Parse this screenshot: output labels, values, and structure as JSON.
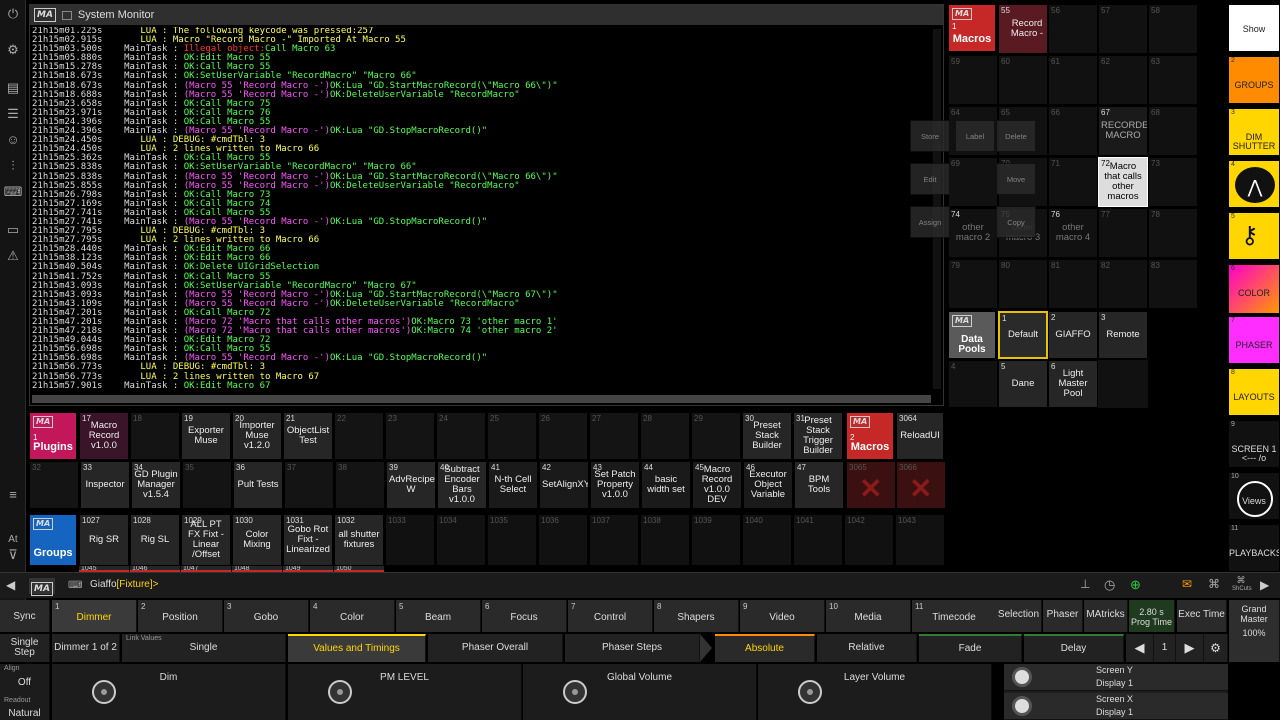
{
  "app": {
    "window_title": "System Monitor",
    "logo": "MA"
  },
  "leftbar": {
    "buttons": [
      "power-icon",
      "gear-icon",
      "clipboard-icon",
      "sliders-icon",
      "user-icon",
      "faders-icon",
      "keyboard-icon",
      "display-icon",
      "warning-icon",
      "list-icon",
      "filter-icon"
    ],
    "at_label": "At"
  },
  "log_lines": [
    [
      [
        "21h15m01.225s       ",
        "ts"
      ],
      [
        "LUA : ",
        "y"
      ],
      [
        "The following keycode was pressed:257",
        "y"
      ]
    ],
    [
      [
        "21h15m02.915s       ",
        "ts"
      ],
      [
        "LUA : ",
        "y"
      ],
      [
        "Macro \"Record Macro -\" Imported At Macro 55",
        "y"
      ]
    ],
    [
      [
        "21h15m03.500s    MainTask : ",
        "ts"
      ],
      [
        "Illegal object:",
        "r"
      ],
      [
        "Call Macro 63",
        "g"
      ]
    ],
    [
      [
        "21h15m05.880s    MainTask : ",
        "ts"
      ],
      [
        "OK:Edit Macro 55",
        "g"
      ]
    ],
    [
      [
        "21h15m15.278s    MainTask : ",
        "ts"
      ],
      [
        "OK:Call Macro 55",
        "g"
      ]
    ],
    [
      [
        "21h15m18.673s    MainTask : ",
        "ts"
      ],
      [
        "OK:SetUserVariable \"RecordMacro\" \"Macro 66\"",
        "g"
      ]
    ],
    [
      [
        "21h15m18.673s    MainTask : ",
        "ts"
      ],
      [
        "(Macro 55 'Record Macro -')",
        "m"
      ],
      [
        "OK:Lua \"GD.StartMacroRecord(\\\"Macro 66\\\")\"",
        "g"
      ]
    ],
    [
      [
        "21h15m18.688s    MainTask : ",
        "ts"
      ],
      [
        "(Macro 55 'Record Macro -')",
        "m"
      ],
      [
        "OK:DeleteUserVariable \"RecordMacro\"",
        "g"
      ]
    ],
    [
      [
        "21h15m23.658s    MainTask : ",
        "ts"
      ],
      [
        "OK:Call Macro 75",
        "g"
      ]
    ],
    [
      [
        "21h15m23.971s    MainTask : ",
        "ts"
      ],
      [
        "OK:Call Macro 76",
        "g"
      ]
    ],
    [
      [
        "21h15m24.396s    MainTask : ",
        "ts"
      ],
      [
        "OK:Call Macro 55",
        "g"
      ]
    ],
    [
      [
        "21h15m24.396s    MainTask : ",
        "ts"
      ],
      [
        "(Macro 55 'Record Macro -')",
        "m"
      ],
      [
        "OK:Lua \"GD.StopMacroRecord()\"",
        "g"
      ]
    ],
    [
      [
        "21h15m24.450s       ",
        "ts"
      ],
      [
        "LUA : ",
        "y"
      ],
      [
        "DEBUG: #cmdTbl: 3",
        "y"
      ]
    ],
    [
      [
        "21h15m24.450s       ",
        "ts"
      ],
      [
        "LUA : ",
        "y"
      ],
      [
        "2 lines written to Macro 66",
        "y"
      ]
    ],
    [
      [
        "21h15m25.362s    MainTask : ",
        "ts"
      ],
      [
        "OK:Call Macro 55",
        "g"
      ]
    ],
    [
      [
        "21h15m25.838s    MainTask : ",
        "ts"
      ],
      [
        "OK:SetUserVariable \"RecordMacro\" \"Macro 66\"",
        "g"
      ]
    ],
    [
      [
        "21h15m25.838s    MainTask : ",
        "ts"
      ],
      [
        "(Macro 55 'Record Macro -')",
        "m"
      ],
      [
        "OK:Lua \"GD.StartMacroRecord(\\\"Macro 66\\\")\"",
        "g"
      ]
    ],
    [
      [
        "21h15m25.855s    MainTask : ",
        "ts"
      ],
      [
        "(Macro 55 'Record Macro -')",
        "m"
      ],
      [
        "OK:DeleteUserVariable \"RecordMacro\"",
        "g"
      ]
    ],
    [
      [
        "21h15m26.798s    MainTask : ",
        "ts"
      ],
      [
        "OK:Call Macro 73",
        "g"
      ]
    ],
    [
      [
        "21h15m27.169s    MainTask : ",
        "ts"
      ],
      [
        "OK:Call Macro 74",
        "g"
      ]
    ],
    [
      [
        "21h15m27.741s    MainTask : ",
        "ts"
      ],
      [
        "OK:Call Macro 55",
        "g"
      ]
    ],
    [
      [
        "21h15m27.741s    MainTask : ",
        "ts"
      ],
      [
        "(Macro 55 'Record Macro -')",
        "m"
      ],
      [
        "OK:Lua \"GD.StopMacroRecord()\"",
        "g"
      ]
    ],
    [
      [
        "21h15m27.795s       ",
        "ts"
      ],
      [
        "LUA : ",
        "y"
      ],
      [
        "DEBUG: #cmdTbl: 3",
        "y"
      ]
    ],
    [
      [
        "21h15m27.795s       ",
        "ts"
      ],
      [
        "LUA : ",
        "y"
      ],
      [
        "2 lines written to Macro 66",
        "y"
      ]
    ],
    [
      [
        "21h15m28.440s    MainTask : ",
        "ts"
      ],
      [
        "OK:Edit Macro 66",
        "g"
      ]
    ],
    [
      [
        "21h15m38.123s    MainTask : ",
        "ts"
      ],
      [
        "OK:Edit Macro 66",
        "g"
      ]
    ],
    [
      [
        "21h15m40.504s    MainTask : ",
        "ts"
      ],
      [
        "OK:Delete UIGridSelection",
        "g"
      ]
    ],
    [
      [
        "21h15m41.752s    MainTask : ",
        "ts"
      ],
      [
        "OK:Call Macro 55",
        "g"
      ]
    ],
    [
      [
        "21h15m43.093s    MainTask : ",
        "ts"
      ],
      [
        "OK:SetUserVariable \"RecordMacro\" \"Macro 67\"",
        "g"
      ]
    ],
    [
      [
        "21h15m43.093s    MainTask : ",
        "ts"
      ],
      [
        "(Macro 55 'Record Macro -')",
        "m"
      ],
      [
        "OK:Lua \"GD.StartMacroRecord(\\\"Macro 67\\\")\"",
        "g"
      ]
    ],
    [
      [
        "21h15m43.109s    MainTask : ",
        "ts"
      ],
      [
        "(Macro 55 'Record Macro -')",
        "m"
      ],
      [
        "OK:DeleteUserVariable \"RecordMacro\"",
        "g"
      ]
    ],
    [
      [
        "21h15m47.201s    MainTask : ",
        "ts"
      ],
      [
        "OK:Call Macro 72",
        "g"
      ]
    ],
    [
      [
        "21h15m47.201s    MainTask : ",
        "ts"
      ],
      [
        "(Macro 72 'Macro that calls other macros')",
        "m"
      ],
      [
        "OK:Macro 73 'other macro 1'",
        "g"
      ]
    ],
    [
      [
        "21h15m47.218s    MainTask : ",
        "ts"
      ],
      [
        "(Macro 72 'Macro that calls other macros')",
        "m"
      ],
      [
        "OK:Macro 74 'other macro 2'",
        "g"
      ]
    ],
    [
      [
        "21h15m49.044s    MainTask : ",
        "ts"
      ],
      [
        "OK:Edit Macro 72",
        "g"
      ]
    ],
    [
      [
        "21h15m56.698s    MainTask : ",
        "ts"
      ],
      [
        "OK:Call Macro 55",
        "g"
      ]
    ],
    [
      [
        "21h15m56.698s    MainTask : ",
        "ts"
      ],
      [
        "(Macro 55 'Record Macro -')",
        "m"
      ],
      [
        "OK:Lua \"GD.StopMacroRecord()\"",
        "g"
      ]
    ],
    [
      [
        "21h15m56.773s       ",
        "ts"
      ],
      [
        "LUA : ",
        "y"
      ],
      [
        "DEBUG: #cmdTbl: 3",
        "y"
      ]
    ],
    [
      [
        "21h15m56.773s       ",
        "ts"
      ],
      [
        "LUA : ",
        "y"
      ],
      [
        "2 lines written to Macro 67",
        "y"
      ]
    ],
    [
      [
        "21h15m57.901s    MainTask : ",
        "ts"
      ],
      [
        "OK:Edit Macro 67",
        "g"
      ]
    ]
  ],
  "macros_pool": {
    "header_number": "1",
    "header_label": "Macros",
    "tiles": [
      {
        "n": "55",
        "label": "Record Macro -"
      },
      {
        "n": "56",
        "label": ""
      },
      {
        "n": "57",
        "label": ""
      },
      {
        "n": "58",
        "label": ""
      },
      {
        "n": "59",
        "label": ""
      },
      {
        "n": "60",
        "label": ""
      },
      {
        "n": "61",
        "label": ""
      },
      {
        "n": "62",
        "label": ""
      },
      {
        "n": "63",
        "label": ""
      },
      {
        "n": "64",
        "label": ""
      },
      {
        "n": "65",
        "label": ""
      },
      {
        "n": "66",
        "label": ""
      },
      {
        "n": "67",
        "label": "RECORDED MACRO"
      },
      {
        "n": "68",
        "label": ""
      },
      {
        "n": "69",
        "label": ""
      },
      {
        "n": "70",
        "label": ""
      },
      {
        "n": "71",
        "label": ""
      },
      {
        "n": "72",
        "label": "Macro that calls other macros"
      },
      {
        "n": "73",
        "label": ""
      },
      {
        "n": "74",
        "label": "other macro 2"
      },
      {
        "n": "75",
        "label": "other macro 3"
      },
      {
        "n": "76",
        "label": "other macro 4"
      },
      {
        "n": "77",
        "label": ""
      },
      {
        "n": "78",
        "label": ""
      },
      {
        "n": "79",
        "label": ""
      },
      {
        "n": "80",
        "label": ""
      },
      {
        "n": "81",
        "label": ""
      },
      {
        "n": "82",
        "label": ""
      },
      {
        "n": "83",
        "label": ""
      },
      {
        "n": "84",
        "label": ""
      },
      {
        "n": "85",
        "label": ""
      },
      {
        "n": "86",
        "label": ""
      },
      {
        "n": "87",
        "label": ""
      },
      {
        "n": "88",
        "label": ""
      },
      {
        "n": "89",
        "label": ""
      }
    ]
  },
  "context_menu": {
    "store": "Store",
    "label": "Label",
    "delete": "Delete",
    "edit": "Edit",
    "move": "Move",
    "assign": "Assign",
    "copy": "Copy"
  },
  "data_pools": {
    "header": "Data Pools",
    "tiles": [
      {
        "n": "1",
        "label": "Default"
      },
      {
        "n": "2",
        "label": "GIAFFO"
      },
      {
        "n": "3",
        "label": "Remote"
      },
      {
        "n": "4",
        "label": ""
      },
      {
        "n": "5",
        "label": "Dane"
      },
      {
        "n": "6",
        "label": "Light Master Pool"
      }
    ]
  },
  "plugins": {
    "header_number": "1",
    "header_label": "Plugins",
    "row1": [
      {
        "n": "17",
        "label": "Macro Record v1.0.0"
      },
      {
        "n": "18",
        "label": ""
      },
      {
        "n": "19",
        "label": "Exporter Muse"
      },
      {
        "n": "20",
        "label": "Importer Muse v1.2.0"
      },
      {
        "n": "21",
        "label": "ObjectList Test"
      },
      {
        "n": "22",
        "label": ""
      },
      {
        "n": "23",
        "label": ""
      },
      {
        "n": "24",
        "label": ""
      },
      {
        "n": "25",
        "label": ""
      },
      {
        "n": "26",
        "label": ""
      },
      {
        "n": "27",
        "label": ""
      },
      {
        "n": "28",
        "label": ""
      },
      {
        "n": "29",
        "label": ""
      },
      {
        "n": "30",
        "label": "Preset Stack Builder"
      },
      {
        "n": "31",
        "label": "Preset Stack Trigger Builder"
      }
    ],
    "row2": [
      {
        "n": "32",
        "label": ""
      },
      {
        "n": "33",
        "label": "Inspector"
      },
      {
        "n": "34",
        "label": "GD Plugin Manager v1.5.4"
      },
      {
        "n": "35",
        "label": ""
      },
      {
        "n": "36",
        "label": "Pult Tests"
      },
      {
        "n": "37",
        "label": ""
      },
      {
        "n": "38",
        "label": ""
      },
      {
        "n": "39",
        "label": "AdvRecipe W"
      },
      {
        "n": "40",
        "label": "Subtract Encoder Bars v1.0.0"
      },
      {
        "n": "41",
        "label": "N-th Cell Select"
      },
      {
        "n": "42",
        "label": "SetAlignXY"
      },
      {
        "n": "43",
        "label": "Set Patch Property v1.0.0"
      },
      {
        "n": "44",
        "label": "basic width set"
      },
      {
        "n": "45",
        "label": "Macro Record v1.0.0 DEV"
      },
      {
        "n": "46",
        "label": "Executor Object Variable"
      },
      {
        "n": "47",
        "label": "BPM Tools"
      }
    ]
  },
  "macros2": {
    "header_number": "2",
    "header_label": "Macros",
    "tile": {
      "n": "3064",
      "label": "ReloadUI"
    },
    "tile2": {
      "n": "3065",
      "label": ""
    },
    "tile3": {
      "n": "3066",
      "label": ""
    }
  },
  "groups": {
    "header_label": "Groups",
    "tiles": [
      {
        "n": "1027",
        "label": "Rig SR"
      },
      {
        "n": "1028",
        "label": "Rig SL"
      },
      {
        "n": "1029",
        "label": "ALL PT FX Fixt - Linear /Offset"
      },
      {
        "n": "1030",
        "label": "Color Mixing"
      },
      {
        "n": "1031",
        "label": "Gobo Rot Fixt - Linearized"
      },
      {
        "n": "1032",
        "label": "all shutter fixtures"
      },
      {
        "n": "1033",
        "label": ""
      },
      {
        "n": "1034",
        "label": ""
      },
      {
        "n": "1035",
        "label": ""
      },
      {
        "n": "1036",
        "label": ""
      },
      {
        "n": "1037",
        "label": ""
      },
      {
        "n": "1038",
        "label": ""
      },
      {
        "n": "1039",
        "label": ""
      },
      {
        "n": "1040",
        "label": ""
      },
      {
        "n": "1041",
        "label": ""
      },
      {
        "n": "1042",
        "label": ""
      },
      {
        "n": "1043",
        "label": ""
      }
    ],
    "row2_nums": [
      "1045",
      "1046",
      "1047",
      "1048",
      "1049",
      "1050"
    ]
  },
  "right_views": [
    {
      "n": "",
      "label": "Show"
    },
    {
      "n": "2",
      "label": "GROUPS"
    },
    {
      "n": "3",
      "label": "DIM SHUTTER"
    },
    {
      "n": "4",
      "label": ""
    },
    {
      "n": "5",
      "label": ""
    },
    {
      "n": "6",
      "label": "COLOR"
    },
    {
      "n": "7",
      "label": "PHASER"
    },
    {
      "n": "8",
      "label": "LAYOUTS"
    },
    {
      "n": "9",
      "label": "SCREEN 1 <--- /o"
    },
    {
      "n": "10",
      "label": "Views"
    },
    {
      "n": "11",
      "label": "PLAYBACKS"
    }
  ],
  "cmdline": {
    "prompt": "Giaffo",
    "object": "[Fixture]>",
    "shortcuts_label": "ShCuts"
  },
  "tabs": {
    "sync": "Sync",
    "items": [
      {
        "n": "1",
        "label": "Dimmer"
      },
      {
        "n": "2",
        "label": "Position"
      },
      {
        "n": "3",
        "label": "Gobo"
      },
      {
        "n": "4",
        "label": "Color"
      },
      {
        "n": "5",
        "label": "Beam"
      },
      {
        "n": "6",
        "label": "Focus"
      },
      {
        "n": "7",
        "label": "Control"
      },
      {
        "n": "8",
        "label": "Shapers"
      },
      {
        "n": "9",
        "label": "Video"
      },
      {
        "n": "10",
        "label": "Media"
      },
      {
        "n": "11",
        "label": "Timecode"
      }
    ],
    "selection": "Selection",
    "phaser": "Phaser",
    "matricks": "MAtricks",
    "prog_time_val": "2.80 s",
    "prog_time": "Prog Time",
    "exec_time": "Exec Time",
    "grand_master": "Grand Master",
    "grand_master_val": "100%"
  },
  "row2": {
    "single_step": "Single Step",
    "dimmer_page": "Dimmer 1 of 2",
    "link_values": "Link Values",
    "single": "Single",
    "values_timings": "Values and Timings",
    "phaser_overall": "Phaser Overall",
    "phaser_steps": "Phaser Steps",
    "absolute": "Absolute",
    "relative": "Relative",
    "fade": "Fade",
    "delay": "Delay",
    "page": "1"
  },
  "row3": {
    "align": "Align",
    "align_val": "Off",
    "readout": "Readout",
    "readout_val": "Natural",
    "enc1": "Dim",
    "enc2": "PM LEVEL",
    "enc3": "Global Volume",
    "enc4": "Layer Volume",
    "screen_y": "Screen Y",
    "display1": "Display 1",
    "screen_x": "Screen X",
    "display2": "Display 1"
  },
  "colors": {
    "plugins_header": "#c2185b",
    "macros_header": "#c62828",
    "groups_header": "#1565c0",
    "accent_yellow": "#ffd600",
    "selected_outline": "#e6c200"
  }
}
